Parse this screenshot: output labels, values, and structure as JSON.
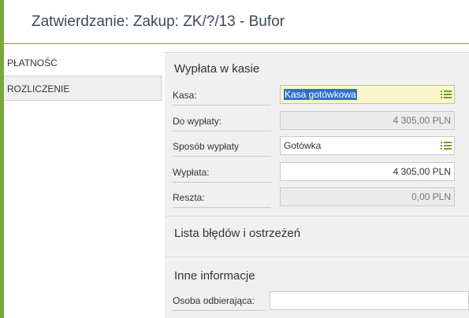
{
  "window": {
    "title": "Zatwierdzanie: Zakup: ZK/?/13 - Bufor"
  },
  "nav": {
    "items": [
      {
        "label": "PŁATNOŚĆ"
      },
      {
        "label": "ROZLICZENIE"
      }
    ]
  },
  "payout": {
    "title": "Wypłata w kasie",
    "kasa_label": "Kasa:",
    "kasa_value": "Kasa gotówkowa",
    "do_wyplaty_label": "Do wypłaty:",
    "do_wyplaty_value": "4 305,00 PLN",
    "sposob_label": "Sposób wypłaty",
    "sposob_value": "Gotówka",
    "wyplata_label": "Wypłata:",
    "wyplata_value": "4 305,00 PLN",
    "reszta_label": "Reszta:",
    "reszta_value": "0,00 PLN"
  },
  "errors": {
    "title": "Lista błędów i ostrzeżeń"
  },
  "other": {
    "title": "Inne informacje",
    "osoba_label": "Osoba odbierająca:",
    "osoba_value": ""
  },
  "colors": {
    "accent": "#7aa63a",
    "list_icon": "#6aa21e",
    "selection": "#2f6fc9",
    "focused_field": "#fbf6c9"
  },
  "icons": {
    "kasa_picker": "list-icon",
    "sposob_picker": "list-icon"
  }
}
